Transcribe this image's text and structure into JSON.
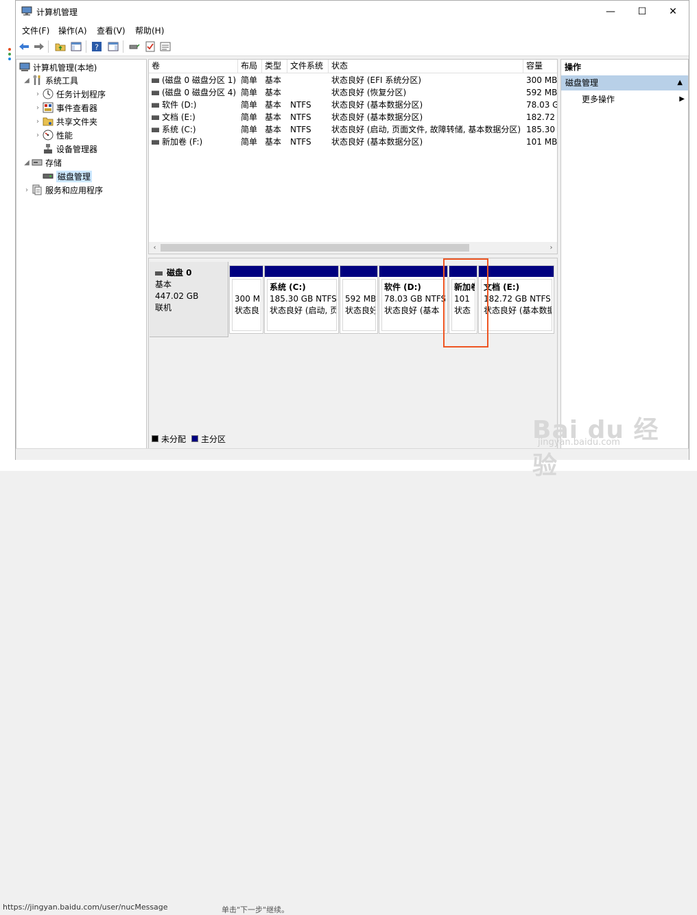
{
  "window": {
    "title": "计算机管理",
    "minimize": "—",
    "maximize": "☐",
    "close": "✕"
  },
  "menu": [
    "文件(F)",
    "操作(A)",
    "查看(V)",
    "帮助(H)"
  ],
  "tree": {
    "root": "计算机管理(本地)",
    "system_tools": "系统工具",
    "task_scheduler": "任务计划程序",
    "event_viewer": "事件查看器",
    "shared_folders": "共享文件夹",
    "performance": "性能",
    "device_manager": "设备管理器",
    "storage": "存储",
    "disk_management": "磁盘管理",
    "services": "服务和应用程序"
  },
  "list": {
    "columns": [
      "卷",
      "布局",
      "类型",
      "文件系统",
      "状态",
      "容量"
    ],
    "rows": [
      [
        "(磁盘 0 磁盘分区 1)",
        "简单",
        "基本",
        "",
        "状态良好 (EFI 系统分区)",
        "300 MB"
      ],
      [
        "(磁盘 0 磁盘分区 4)",
        "简单",
        "基本",
        "",
        "状态良好 (恢复分区)",
        "592 MB"
      ],
      [
        "软件 (D:)",
        "简单",
        "基本",
        "NTFS",
        "状态良好 (基本数据分区)",
        "78.03 G"
      ],
      [
        "文档 (E:)",
        "简单",
        "基本",
        "NTFS",
        "状态良好 (基本数据分区)",
        "182.72"
      ],
      [
        "系统 (C:)",
        "简单",
        "基本",
        "NTFS",
        "状态良好 (启动, 页面文件, 故障转储, 基本数据分区)",
        "185.30"
      ],
      [
        "新加卷 (F:)",
        "简单",
        "基本",
        "NTFS",
        "状态良好 (基本数据分区)",
        "101 MB"
      ]
    ]
  },
  "disk": {
    "name": "磁盘 0",
    "type": "基本",
    "size": "447.02 GB",
    "status": "联机",
    "partitions": [
      {
        "name": "",
        "size": "300 M",
        "status": "状态良"
      },
      {
        "name": "系统 (C:)",
        "size": "185.30 GB NTFS",
        "status": "状态良好 (启动, 页"
      },
      {
        "name": "",
        "size": "592 MB",
        "status": "状态良好"
      },
      {
        "name": "软件 (D:)",
        "size": "78.03 GB NTFS",
        "status": "状态良好 (基本"
      },
      {
        "name": "新加卷 (F:)",
        "size": "101",
        "status": "状态"
      },
      {
        "name": "文档 (E:)",
        "size": "182.72 GB NTFS",
        "status": "状态良好 (基本数据"
      }
    ]
  },
  "legend": {
    "unallocated": "未分配",
    "primary": "主分区"
  },
  "actions": {
    "title": "操作",
    "section": "磁盘管理",
    "more": "更多操作"
  },
  "background": {
    "url": "https://jingyan.baidu.com/user/nucMessage",
    "text": "单击\"下一步\"继续。"
  },
  "watermark": {
    "brand": "Bai du 经验",
    "domain": "jingyan.baidu.com"
  },
  "colors": {
    "primary_partition": "#00007f",
    "highlight": "#ee5522",
    "selection": "#cce8ff",
    "action_header": "#b8d0e8"
  }
}
